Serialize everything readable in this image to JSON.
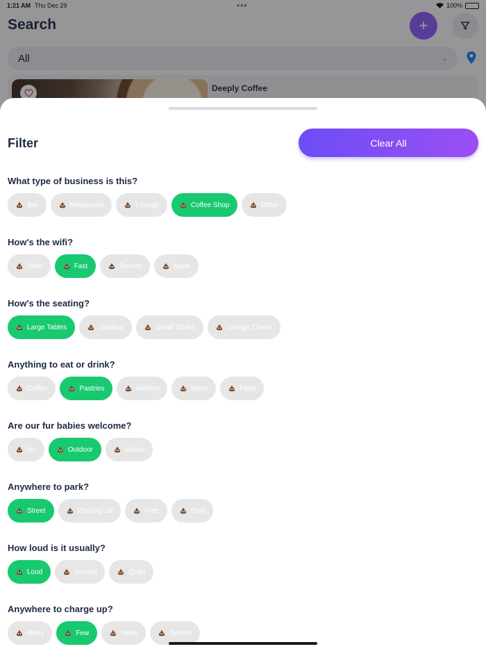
{
  "status_bar": {
    "time": "1:21 AM",
    "date": "Thu Dec 29",
    "battery": "100%"
  },
  "background": {
    "title": "Search",
    "add_label": "+",
    "select_value": "All",
    "card_title": "Deeply Coffee"
  },
  "filter": {
    "title": "Filter",
    "clear_label": "Clear All",
    "sections": [
      {
        "question": "What type of business is this?",
        "options": [
          {
            "label": "Bar",
            "selected": false
          },
          {
            "label": "Restaurant",
            "selected": false
          },
          {
            "label": "Lounge",
            "selected": false
          },
          {
            "label": "Coffee Shop",
            "selected": true
          },
          {
            "label": "Other",
            "selected": false
          }
        ]
      },
      {
        "question": "How's the wifi?",
        "options": [
          {
            "label": "Slow",
            "selected": false
          },
          {
            "label": "Fast",
            "selected": true
          },
          {
            "label": "Decent",
            "selected": false
          },
          {
            "label": "None",
            "selected": false
          }
        ]
      },
      {
        "question": "How's the seating?",
        "options": [
          {
            "label": "Large Tables",
            "selected": true
          },
          {
            "label": "Outdoor",
            "selected": false
          },
          {
            "label": "Small Tables",
            "selected": false
          },
          {
            "label": "Lounge Chairs",
            "selected": false
          }
        ]
      },
      {
        "question": "Anything to eat or drink?",
        "options": [
          {
            "label": "Coffee",
            "selected": false
          },
          {
            "label": "Pastries",
            "selected": true
          },
          {
            "label": "Alcohol",
            "selected": false
          },
          {
            "label": "None",
            "selected": false
          },
          {
            "label": "Food",
            "selected": false
          }
        ]
      },
      {
        "question": "Are our fur babies welcome?",
        "options": [
          {
            "label": "No",
            "selected": false
          },
          {
            "label": "Outdoor",
            "selected": true
          },
          {
            "label": "Indoor",
            "selected": false
          }
        ]
      },
      {
        "question": "Anywhere to park?",
        "options": [
          {
            "label": "Street",
            "selected": true
          },
          {
            "label": "Parking Lot",
            "selected": false
          },
          {
            "label": "Free",
            "selected": false
          },
          {
            "label": "Paid",
            "selected": false
          }
        ]
      },
      {
        "question": "How loud is it usually?",
        "options": [
          {
            "label": "Loud",
            "selected": true
          },
          {
            "label": "Normal",
            "selected": false
          },
          {
            "label": "Quiet",
            "selected": false
          }
        ]
      },
      {
        "question": "Anywhere to charge up?",
        "options": [
          {
            "label": "Many",
            "selected": false
          },
          {
            "label": "Few",
            "selected": true
          },
          {
            "label": "None",
            "selected": false
          },
          {
            "label": "Decent",
            "selected": false
          }
        ]
      }
    ]
  },
  "icons": {
    "chip_icon": "poop-emoji-icon",
    "filter_icon": "funnel-icon",
    "location_icon": "location-pin-icon"
  },
  "colors": {
    "accent_start": "#6d4df6",
    "accent_end": "#9b4ef3",
    "selected_chip": "#18c96f",
    "unselected_chip": "#e6e6e6",
    "heading": "#1e2a44"
  }
}
